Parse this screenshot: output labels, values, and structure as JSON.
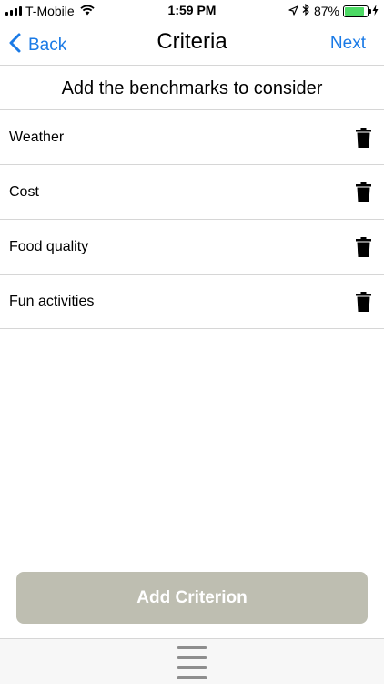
{
  "status_bar": {
    "carrier": "T-Mobile",
    "time": "1:59 PM",
    "battery_percent": "87%",
    "battery_level": 0.87,
    "battery_color": "#4cd964"
  },
  "nav": {
    "back_label": "Back",
    "title": "Criteria",
    "next_label": "Next",
    "accent_color": "#1a7ae6"
  },
  "subtitle": "Add the benchmarks to consider",
  "criteria": [
    {
      "label": "Weather",
      "delete_icon": "trash-icon"
    },
    {
      "label": "Cost",
      "delete_icon": "trash-icon"
    },
    {
      "label": "Food quality",
      "delete_icon": "trash-icon"
    },
    {
      "label": "Fun activities",
      "delete_icon": "trash-icon"
    }
  ],
  "add_button": {
    "label": "Add Criterion",
    "color": "#bebeb1"
  },
  "bottom_bar": {
    "menu_icon": "hamburger-menu-icon"
  }
}
